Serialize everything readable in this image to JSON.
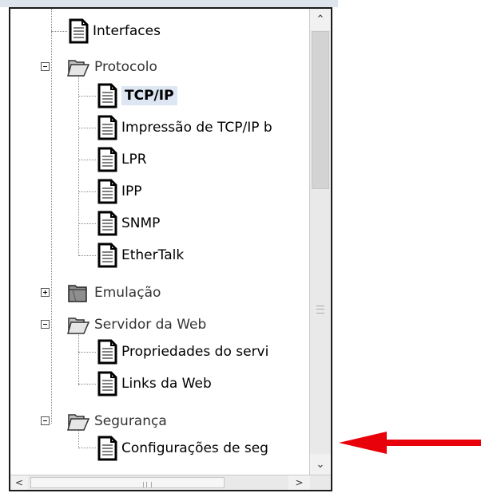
{
  "tree": {
    "items": [
      {
        "label": "Interfaces",
        "kind": "leaf",
        "icon": "document-icon"
      },
      {
        "label": "Protocolo",
        "kind": "folder",
        "expanded": true,
        "icon": "folder-open-icon"
      },
      {
        "label": "TCP/IP",
        "kind": "leaf",
        "selected": true,
        "icon": "document-icon"
      },
      {
        "label": "Impressão de TCP/IP b",
        "kind": "leaf",
        "icon": "document-icon"
      },
      {
        "label": "LPR",
        "kind": "leaf",
        "icon": "document-icon"
      },
      {
        "label": "IPP",
        "kind": "leaf",
        "icon": "document-icon"
      },
      {
        "label": "SNMP",
        "kind": "leaf",
        "icon": "document-icon"
      },
      {
        "label": "EtherTalk",
        "kind": "leaf",
        "icon": "document-icon"
      },
      {
        "label": "Emulação",
        "kind": "folder",
        "expanded": false,
        "icon": "folder-closed-icon"
      },
      {
        "label": "Servidor da Web",
        "kind": "folder",
        "expanded": true,
        "icon": "folder-open-icon"
      },
      {
        "label": "Propriedades do servi",
        "kind": "leaf",
        "icon": "document-icon"
      },
      {
        "label": "Links da Web",
        "kind": "leaf",
        "icon": "document-icon"
      },
      {
        "label": "Segurança",
        "kind": "folder",
        "expanded": true,
        "icon": "folder-open-icon"
      },
      {
        "label": "Configurações de seg",
        "kind": "leaf",
        "icon": "document-icon"
      }
    ]
  },
  "scrollbars": {
    "vertical": {
      "up_glyph": "⌃",
      "down_glyph": "⌄",
      "thumb_position": 0.0
    },
    "horizontal": {
      "left_glyph": "<",
      "right_glyph": ">",
      "thumb_position": 0.0
    }
  },
  "annotation": {
    "icon": "arrow-left-icon",
    "color": "#e8000b"
  },
  "colors": {
    "selection": "#dde6f2",
    "border": "#1b1b1b"
  }
}
